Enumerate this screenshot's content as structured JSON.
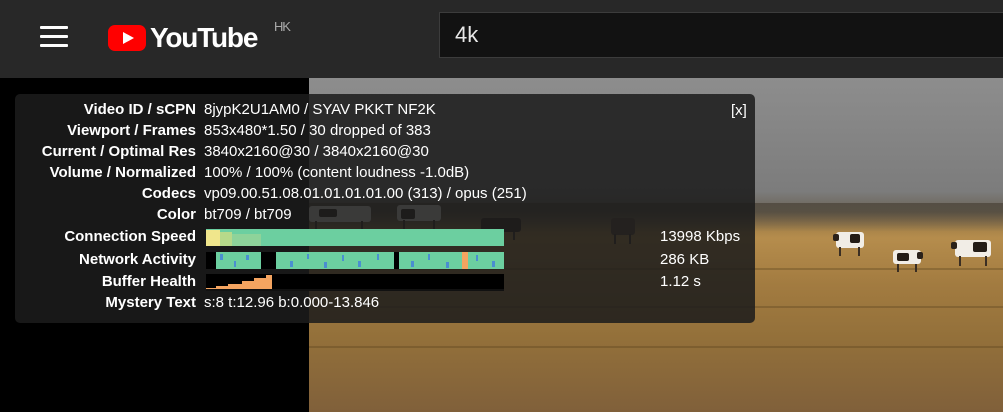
{
  "header": {
    "logo_text": "YouTube",
    "region": "HK",
    "search_value": "4k"
  },
  "stats": {
    "close_label": "[x]",
    "rows": [
      {
        "label": "Video ID / sCPN",
        "value": "8jypK2U1AM0 / SYAV PKKT NF2K"
      },
      {
        "label": "Viewport / Frames",
        "value": "853x480*1.50 / 30 dropped of 383"
      },
      {
        "label": "Current / Optimal Res",
        "value": "3840x2160@30 / 3840x2160@30"
      },
      {
        "label": "Volume / Normalized",
        "value": "100% / 100% (content loudness -1.0dB)"
      },
      {
        "label": "Codecs",
        "value": "vp09.00.51.08.01.01.01.01.00 (313) / opus (251)"
      },
      {
        "label": "Color",
        "value": "bt709 / bt709"
      },
      {
        "label": "Connection Speed",
        "graph_value": "13998 Kbps"
      },
      {
        "label": "Network Activity",
        "graph_value": "286 KB"
      },
      {
        "label": "Buffer Health",
        "graph_value": "1.12 s"
      },
      {
        "label": "Mystery Text",
        "value": "s:8 t:12.96 b:0.000-13.846"
      }
    ]
  },
  "colors": {
    "logo_red": "#ff0000",
    "graph_teal": "#6ccfa0",
    "graph_yellow": "#f0e68c",
    "graph_orange": "#f4a460",
    "graph_blue": "#4a8fd1"
  }
}
